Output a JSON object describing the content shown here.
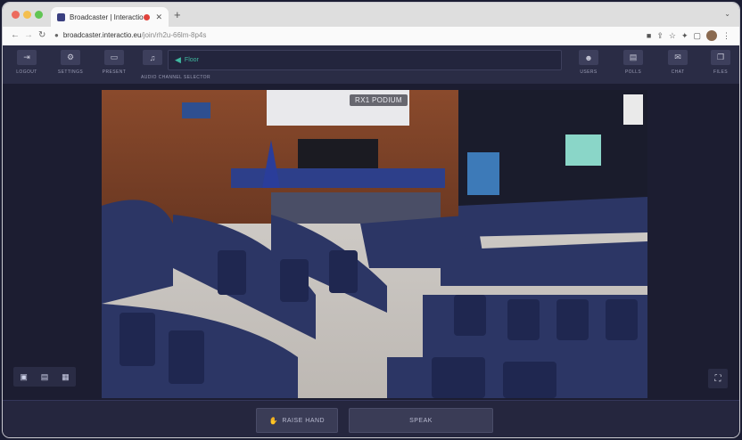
{
  "browser": {
    "tab_title": "Broadcaster | Interactio",
    "new_tab": "+",
    "url_host": "broadcaster.interactio.eu",
    "url_path": "/join/rh2u-66lm-8p4s",
    "dots": [
      "#ec6b5e",
      "#f4bf4f",
      "#61c554"
    ]
  },
  "toolbar": {
    "logout": "LOGOUT",
    "settings": "SETTINGS",
    "present": "PRESENT",
    "audio_channel": "AUDIO CHANNEL SELECTOR",
    "floor": "Floor",
    "users": "USERS",
    "polls": "POLLS",
    "chat": "CHAT",
    "files": "FILES"
  },
  "video": {
    "room_label": "RX1 PODIUM"
  },
  "actions": {
    "raise_hand": "RAISE HAND",
    "speak": "SPEAK"
  },
  "colors": {
    "accent_teal": "#3fb8a0",
    "toolbar_bg": "#2a2c45",
    "page_bg": "#1c1d31"
  }
}
